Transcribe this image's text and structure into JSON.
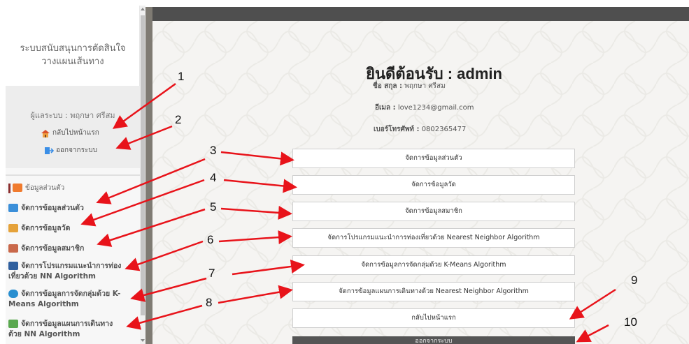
{
  "sidebar": {
    "app_title_line1": "ระบบสนับสนุนการตัดสินใจ",
    "app_title_line2": "วางแผนเส้นทาง",
    "admin_label": "ผู้แลระบบ : พฤกษา ศรีสม",
    "home_link": "กลับไปหน้าแรก",
    "logout_link": "ออกจากระบบ",
    "menu": [
      {
        "label": "ข้อมูลส่วนตัว",
        "icon": "person-icon"
      },
      {
        "label": "จัดการข้อมูลส่วนตัว",
        "icon": "edit-profile-icon"
      },
      {
        "label": "จัดการข้อมูลวัด",
        "icon": "temple-icon"
      },
      {
        "label": "จัดการข้อมูลสมาชิก",
        "icon": "users-icon"
      },
      {
        "label": "จัดการโปรแกรมแนะนำการท่องเที่ยวด้วย NN Algorithm",
        "line1": "จัดการโปรแกรมแนะนำการท่อง",
        "line2": "เที่ยวด้วย NN Algorithm",
        "icon": "monitor-icon"
      },
      {
        "label": "จัดการข้อมูลการจัดกลุ่มด้วย K-Means Algorithm",
        "line1": "จัดการข้อมูลการจัดกลุ่มด้วย K-",
        "line2": "Means Algorithm",
        "icon": "cluster-icon"
      },
      {
        "label": "จัดการข้อมูลแผนการเดินทางด้วย NN Algorithm",
        "line1": "จัดการข้อมูลแผนการเดินทาง",
        "line2": "ด้วย NN Algorithm",
        "icon": "map-icon"
      }
    ]
  },
  "main": {
    "welcome": "ยินดีต้อนรับ : admin",
    "name_label": "ชื่อ สกุล :",
    "name_value": "พฤกษา ศรีสม",
    "email_label": "อีเมล :",
    "email_value": "love1234@gmail.com",
    "phone_label": "เบอร์โทรศัพท์ :",
    "phone_value": "0802365477",
    "buttons": [
      "จัดการข้อมูลส่วนตัว",
      "จัดการข้อมูลวัด",
      "จัดการข้อมูลสมาชิก",
      "จัดการโปรแกรมแนะนำการท่องเที่ยวด้วย Nearest Neighbor Algorithm",
      "จัดการข้อมูลการจัดกลุ่มด้วย K-Means Algorithm",
      "จัดการข้อมูลแผนการเดินทางด้วย Nearest Neighbor Algorithm",
      "กลับไปหน้าแรก",
      "ออกจากระบบ"
    ]
  },
  "annotations": [
    "1",
    "2",
    "3",
    "4",
    "5",
    "6",
    "7",
    "8",
    "9",
    "10"
  ],
  "colors": {
    "arrow": "#e8131a",
    "dark_frame": "#4f4f4f",
    "active_marker": "#8a2d2d"
  }
}
